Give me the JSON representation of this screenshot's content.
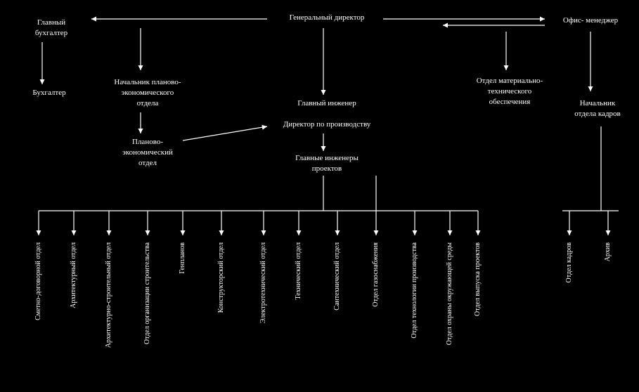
{
  "top": {
    "general_director": "Генеральный директор",
    "chief_accountant": "Главный\nбухгалтер",
    "accountant": "Бухгалтер",
    "head_planning": "Начальник планово-\nэкономического\nотдела",
    "planning_dept": "Планово-\nэкономический\nотдел",
    "chief_engineer": "Главный инженер",
    "production_director": "Директор по производству",
    "chief_project_engineers": "Главные инженеры\nпроектов",
    "mto": "Отдел материально-\nтехнического\nобеспечения",
    "office_manager": "Офис- менеджер",
    "hr_head": "Начальник\nотдела кадров"
  },
  "bottom": [
    "Сметно-договорной отдел",
    "Архитектурный отдел",
    "Архитектурно-строительный отдел",
    "Отдел организации строительства",
    "Генпланов",
    "Конструкторский отдел",
    "Электротехнический отдел",
    "Технический отдел",
    "Сантехнический отдел",
    "Отдел газоснабжения",
    "Отдел технологии производства",
    "Отдел охраны окружающей среды",
    "Отдел выпуска проектов",
    "Отдел кадров",
    "Архив"
  ]
}
